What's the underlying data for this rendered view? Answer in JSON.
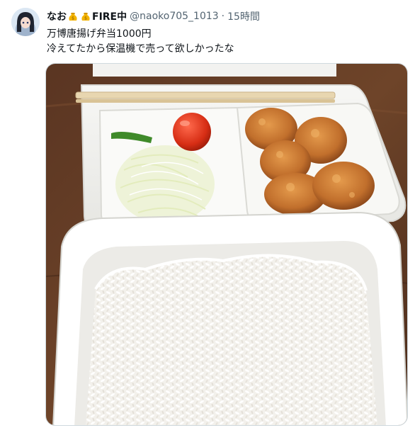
{
  "tweet": {
    "display_name": "なお",
    "name_suffix": "FIRE中",
    "handle": "@naoko705_1013",
    "separator": "·",
    "time": "15時間",
    "text_line1": "万博唐揚げ弁当1000円",
    "text_line2": "冷えてたから保温機で売って欲しかったな"
  },
  "icons": {
    "badge": "money-bag-emoji-icon"
  },
  "colors": {
    "text": "#0f1419",
    "secondary": "#536471",
    "border": "#cfd9de"
  }
}
